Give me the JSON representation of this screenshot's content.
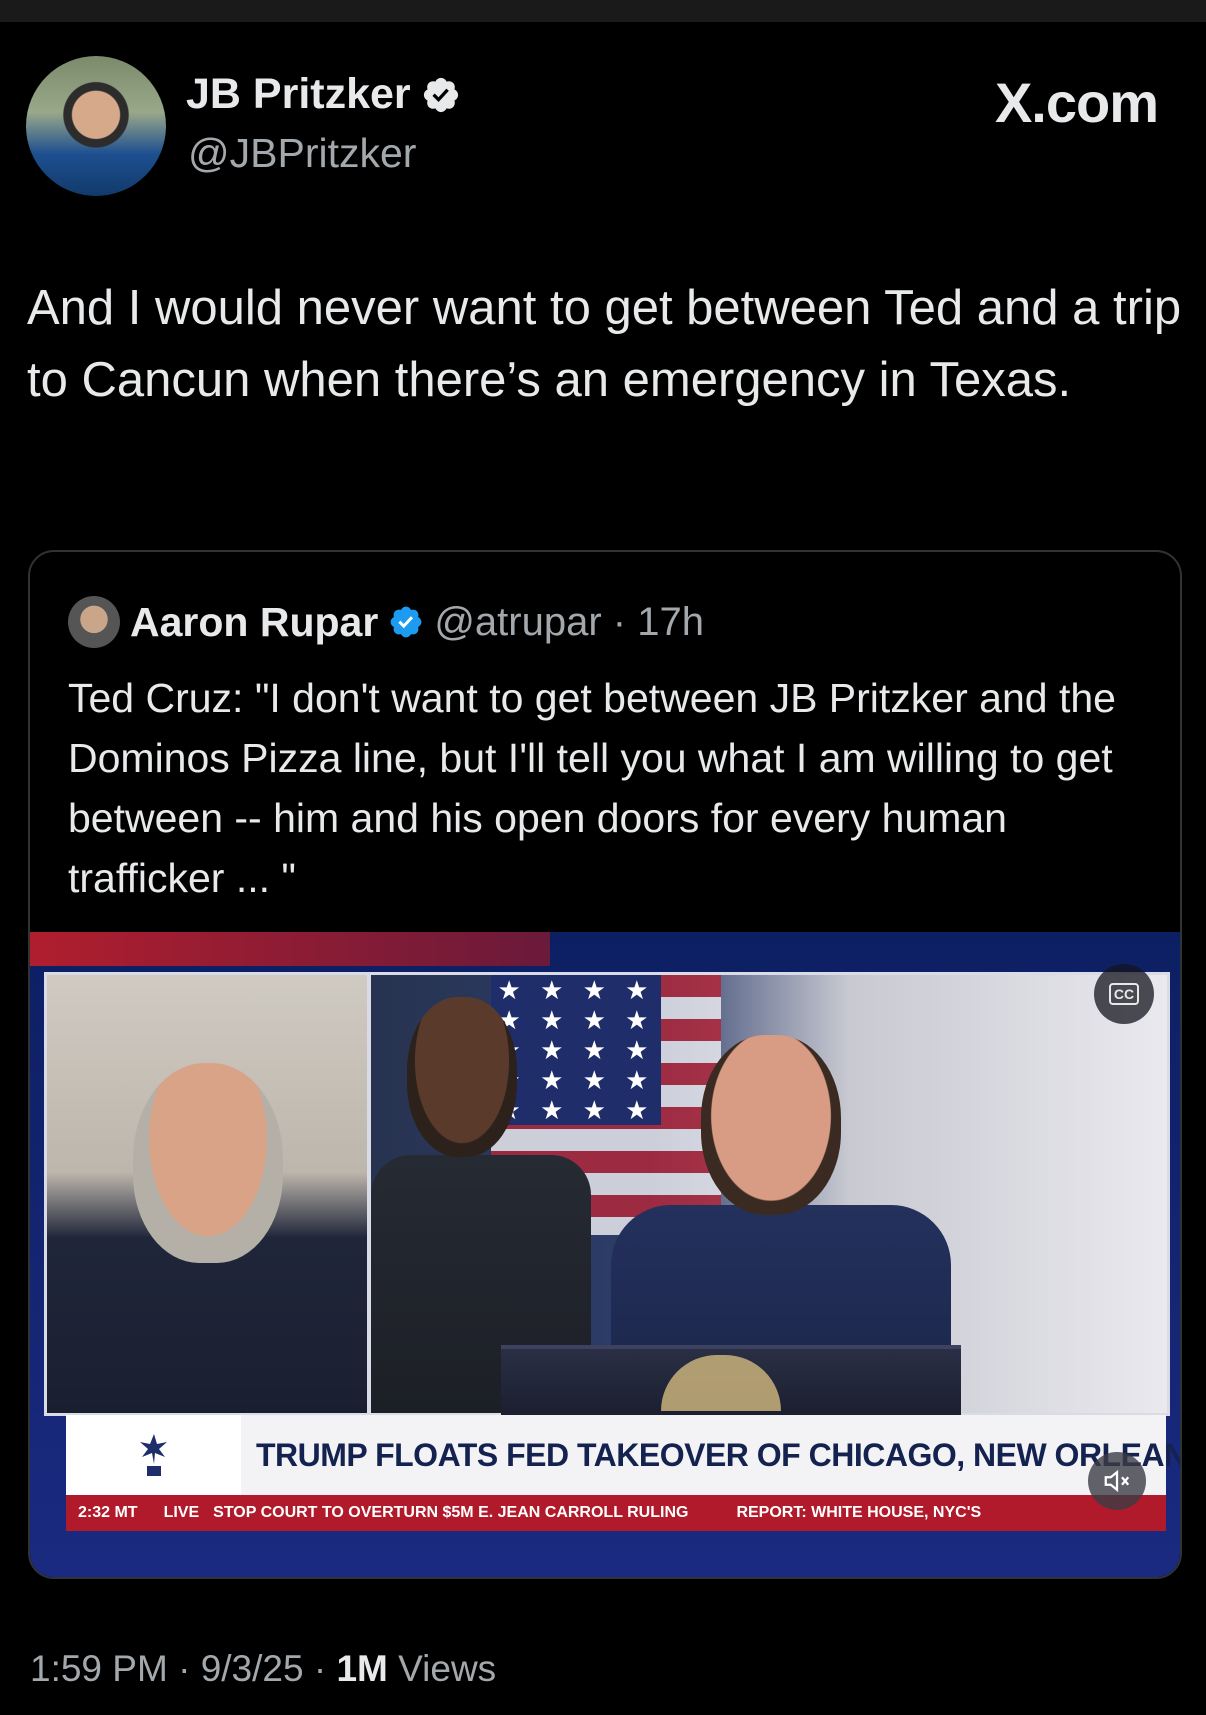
{
  "author": {
    "display_name": "JB Pritzker",
    "handle": "@JBPritzker",
    "verified": true
  },
  "brand": "X.com",
  "tweet_text": "And I would never want to get between Ted and a trip to Cancun when there’s an emergency in Texas.",
  "quoted": {
    "display_name": "Aaron Rupar",
    "handle": "@atrupar",
    "separator": " · ",
    "time_ago": "17h",
    "verified": true,
    "text": "Ted Cruz: \"I don't want to get between JB Pritzker and the Dominos Pizza line, but I'll tell you what I am willing to get between -- him and his open doors for every human trafficker ... \"",
    "video": {
      "cc_label": "CC",
      "headline": "TRUMP FLOATS FED TAKEOVER OF CHICAGO, NEW ORLEANS",
      "ticker_time": "2:32 MT",
      "ticker_live": "LIVE",
      "ticker_items": [
        "STOP COURT TO OVERTURN $5M E. JEAN CARROLL RULING",
        "REPORT: WHITE HOUSE, NYC'S"
      ],
      "stars": "★ ★ ★ ★ ★ ★ ★ ★ ★ ★ ★ ★ ★ ★ ★ ★ ★ ★ ★ ★ ★ ★ ★ ★ ★ ★ ★ ★ ★ ★",
      "muted": true
    }
  },
  "footer": {
    "time": "1:59 PM",
    "date": "9/3/25",
    "views_count": "1M",
    "views_label": "Views",
    "sep": " · "
  },
  "colors": {
    "verified_blue": "#1d9bf0",
    "text_primary": "#e7e9ea",
    "text_secondary": "#a3a8ad",
    "news_red": "#b11a2a",
    "news_navy": "#14224f"
  }
}
